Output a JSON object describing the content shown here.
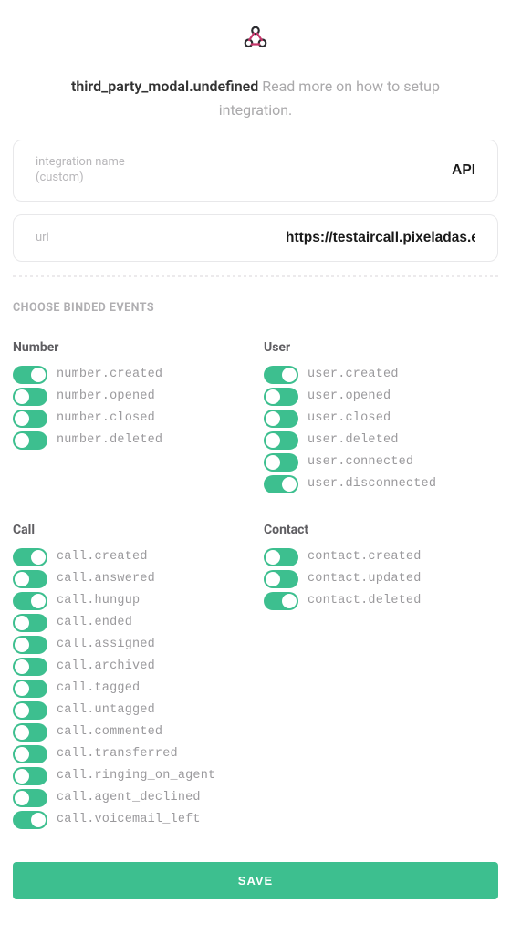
{
  "header": {
    "title": "third_party_modal.undefined",
    "subtitle": "Read more on how to setup integration."
  },
  "fields": {
    "name_label": "integration name\n(custom)",
    "name_value": "API",
    "url_label": "url",
    "url_value": "https://testaircall.pixeladas.es"
  },
  "section_label": "CHOOSE BINDED EVENTS",
  "groups": [
    {
      "title": "Number",
      "events": [
        {
          "label": "number.created",
          "on": true
        },
        {
          "label": "number.opened",
          "on": false
        },
        {
          "label": "number.closed",
          "on": false
        },
        {
          "label": "number.deleted",
          "on": false
        }
      ]
    },
    {
      "title": "User",
      "events": [
        {
          "label": "user.created",
          "on": true
        },
        {
          "label": "user.opened",
          "on": false
        },
        {
          "label": "user.closed",
          "on": false
        },
        {
          "label": "user.deleted",
          "on": false
        },
        {
          "label": "user.connected",
          "on": false
        },
        {
          "label": "user.disconnected",
          "on": true
        }
      ]
    },
    {
      "title": "Call",
      "events": [
        {
          "label": "call.created",
          "on": true
        },
        {
          "label": "call.answered",
          "on": false
        },
        {
          "label": "call.hungup",
          "on": true
        },
        {
          "label": "call.ended",
          "on": false
        },
        {
          "label": "call.assigned",
          "on": false
        },
        {
          "label": "call.archived",
          "on": false
        },
        {
          "label": "call.tagged",
          "on": false
        },
        {
          "label": "call.untagged",
          "on": false
        },
        {
          "label": "call.commented",
          "on": false
        },
        {
          "label": "call.transferred",
          "on": false
        },
        {
          "label": "call.ringing_on_agent",
          "on": false
        },
        {
          "label": "call.agent_declined",
          "on": false
        },
        {
          "label": "call.voicemail_left",
          "on": true
        }
      ]
    },
    {
      "title": "Contact",
      "events": [
        {
          "label": "contact.created",
          "on": false
        },
        {
          "label": "contact.updated",
          "on": false
        },
        {
          "label": "contact.deleted",
          "on": true
        }
      ]
    }
  ],
  "save_label": "SAVE",
  "colors": {
    "accent": "#3dbf8f"
  }
}
